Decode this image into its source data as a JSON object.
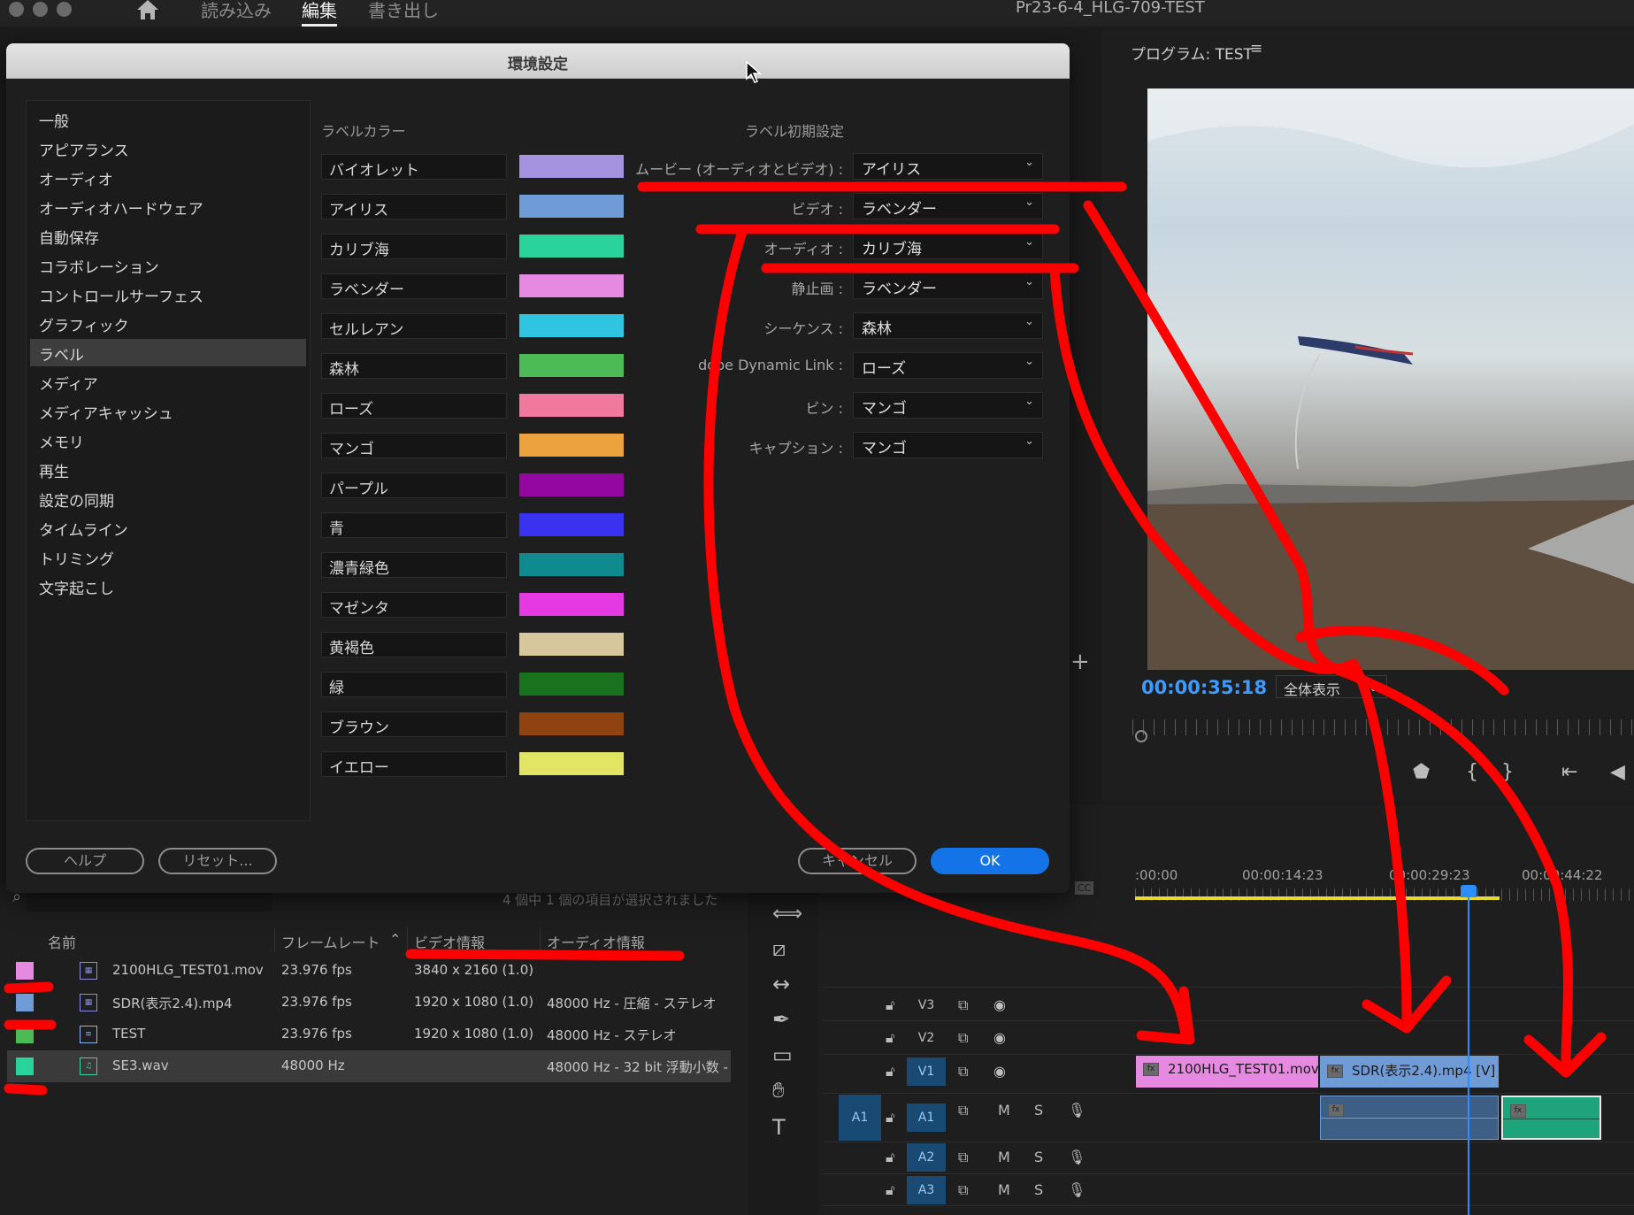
{
  "topbar": {
    "tabs": [
      {
        "label": "読み込み",
        "active": false
      },
      {
        "label": "編集",
        "active": true
      },
      {
        "label": "書き出し",
        "active": false
      }
    ],
    "project_title": "Pr23-6-4_HLG-709-TEST"
  },
  "program_monitor": {
    "title": "プログラム: TEST",
    "menu_icon": "≡",
    "timecode": "00:00:35:18",
    "zoom_label": "全体表示",
    "add_icon": "+"
  },
  "dialog": {
    "title": "環境設定",
    "sidebar": [
      {
        "label": "一般",
        "active": false
      },
      {
        "label": "アピアランス",
        "active": false
      },
      {
        "label": "オーディオ",
        "active": false
      },
      {
        "label": "オーディオハードウェア",
        "active": false
      },
      {
        "label": "自動保存",
        "active": false
      },
      {
        "label": "コラボレーション",
        "active": false
      },
      {
        "label": "コントロールサーフェス",
        "active": false
      },
      {
        "label": "グラフィック",
        "active": false
      },
      {
        "label": "ラベル",
        "active": true
      },
      {
        "label": "メディア",
        "active": false
      },
      {
        "label": "メディアキャッシュ",
        "active": false
      },
      {
        "label": "メモリ",
        "active": false
      },
      {
        "label": "再生",
        "active": false
      },
      {
        "label": "設定の同期",
        "active": false
      },
      {
        "label": "タイムライン",
        "active": false
      },
      {
        "label": "トリミング",
        "active": false
      },
      {
        "label": "文字起こし",
        "active": false
      }
    ],
    "label_colors_title": "ラベルカラー",
    "label_colors": [
      {
        "name": "バイオレット",
        "color": "#a593e0"
      },
      {
        "name": "アイリス",
        "color": "#6f9bd6"
      },
      {
        "name": "カリブ海",
        "color": "#2ad39c"
      },
      {
        "name": "ラベンダー",
        "color": "#e58ae0"
      },
      {
        "name": "セルレアン",
        "color": "#2fc5e0"
      },
      {
        "name": "森林",
        "color": "#4dbb55"
      },
      {
        "name": "ローズ",
        "color": "#f1799d"
      },
      {
        "name": "マンゴ",
        "color": "#eca33e"
      },
      {
        "name": "パープル",
        "color": "#9407a0"
      },
      {
        "name": "青",
        "color": "#3933f1"
      },
      {
        "name": "濃青緑色",
        "color": "#0f8a8f"
      },
      {
        "name": "マゼンタ",
        "color": "#e53ae3"
      },
      {
        "name": "黄褐色",
        "color": "#d6c79d"
      },
      {
        "name": "緑",
        "color": "#18721e"
      },
      {
        "name": "ブラウン",
        "color": "#8e4311"
      },
      {
        "name": "イエロー",
        "color": "#e2e463"
      }
    ],
    "label_defaults_title": "ラベル初期設定",
    "label_defaults": [
      {
        "label": "ムービー (オーディオとビデオ) :",
        "value": "アイリス"
      },
      {
        "label": "ビデオ :",
        "value": "ラベンダー"
      },
      {
        "label": "オーディオ :",
        "value": "カリブ海"
      },
      {
        "label": "静止画 :",
        "value": "ラベンダー"
      },
      {
        "label": "シーケンス :",
        "value": "森林"
      },
      {
        "label": "dobe Dynamic Link :",
        "value": "ローズ"
      },
      {
        "label": "ビン :",
        "value": "マンゴ"
      },
      {
        "label": "キャプション :",
        "value": "マンゴ"
      }
    ],
    "buttons": {
      "help": "ヘルプ",
      "reset": "リセット...",
      "cancel": "キャンセル",
      "ok": "OK"
    }
  },
  "project_panel": {
    "status": "4 個中 1 個の項目が選択されました",
    "columns": {
      "name": "名前",
      "frame_rate": "フレームレート",
      "video_info": "ビデオ情報",
      "audio_info": "オーディオ情報"
    },
    "rows": [
      {
        "color": "#e58ae0",
        "icon": "video-clip-icon",
        "name": "2100HLG_TEST01.mov",
        "fps": "23.976 fps",
        "video": "3840 x 2160 (1.0)",
        "audio": "",
        "selected": false
      },
      {
        "color": "#6f9bd6",
        "icon": "movie-clip-icon",
        "name": "SDR(表示2.4).mp4",
        "fps": "23.976 fps",
        "video": "1920 x 1080 (1.0)",
        "audio": "48000 Hz - 圧縮 - ステレオ",
        "selected": false
      },
      {
        "color": "#4dbb55",
        "icon": "sequence-icon",
        "name": "TEST",
        "fps": "23.976 fps",
        "video": "1920 x 1080 (1.0)",
        "audio": "48000 Hz - ステレオ",
        "selected": false
      },
      {
        "color": "#2ad39c",
        "icon": "audio-clip-icon",
        "name": "SE3.wav",
        "fps": "48000 Hz",
        "video": "",
        "audio": "48000 Hz - 32 bit 浮動小数 -",
        "selected": true
      }
    ]
  },
  "timeline": {
    "ruler": [
      ":00:00",
      "00:00:14:23",
      "00:00:29:23",
      "00:00:44:22"
    ],
    "cc_label": "CC",
    "source_patch": "A1",
    "tracks": [
      {
        "name": "V3",
        "kind": "video",
        "targeted": false
      },
      {
        "name": "V2",
        "kind": "video",
        "targeted": false
      },
      {
        "name": "V1",
        "kind": "video",
        "targeted": true
      },
      {
        "name": "A1",
        "kind": "audio",
        "targeted": true
      },
      {
        "name": "A2",
        "kind": "audio",
        "targeted": true
      },
      {
        "name": "A3",
        "kind": "audio",
        "targeted": true
      }
    ],
    "audio_buttons": {
      "mute": "M",
      "solo": "S"
    },
    "clips": {
      "v1_a": "2100HLG_TEST01.mov",
      "v1_b": "SDR(表示2.4).mp4 [V]",
      "fx": "fx"
    },
    "clip_colors": {
      "hlg": "#e58ae0",
      "sdr_video": "#6f9bd6",
      "sdr_audio": "#3d5f86",
      "se3": "#1fa37a"
    }
  },
  "annotation_color": "#ff0000"
}
